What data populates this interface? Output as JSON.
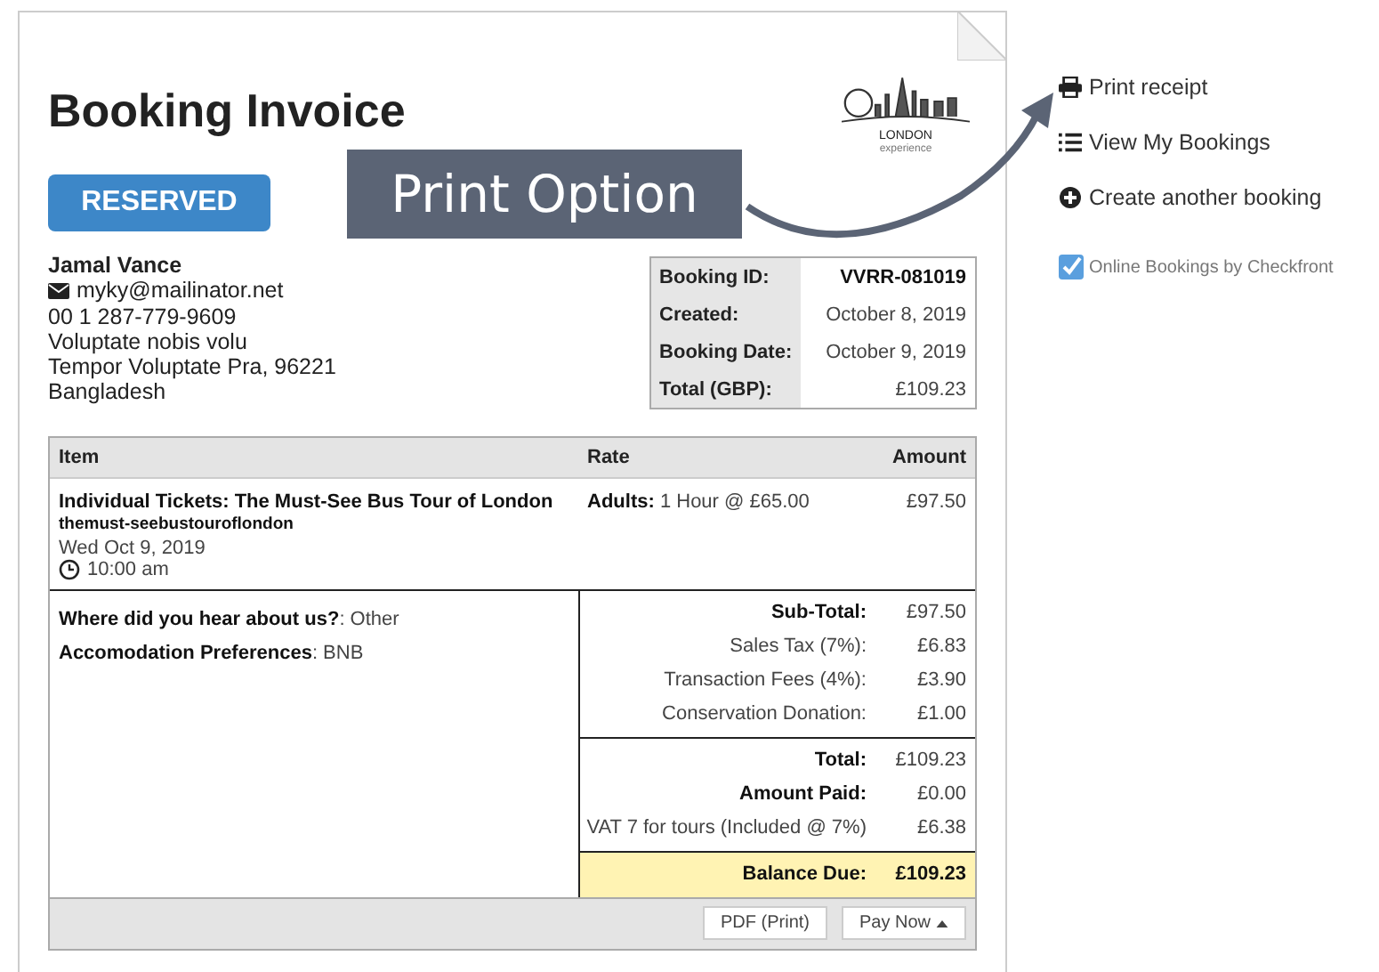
{
  "invoice": {
    "title": "Booking Invoice",
    "logo": {
      "line_1": "LONDON",
      "line_2": "experience"
    },
    "status": "RESERVED",
    "customer": {
      "name": "Jamal Vance",
      "email": "myky@mailinator.net",
      "phone": "00 1 287-779-9609",
      "address_lines": [
        "Voluptate nobis volu",
        "Tempor Voluptate Pra, 96221",
        "Bangladesh"
      ]
    },
    "summary": [
      {
        "label": "Booking ID:",
        "value": "VVRR-081019",
        "bold": true
      },
      {
        "label": "Created:",
        "value": "October 8, 2019",
        "bold": false
      },
      {
        "label": "Booking Date:",
        "value": "October 9, 2019",
        "bold": false
      },
      {
        "label": "Total (GBP):",
        "value": "£109.23",
        "bold": false
      }
    ],
    "table": {
      "columns": [
        "Item",
        "Rate",
        "Amount"
      ],
      "rows": [
        {
          "title": "Individual Tickets: The Must-See Bus Tour of London",
          "code": "themust-seebustouroflondon",
          "date": "Wed Oct 9, 2019",
          "time": "10:00 am",
          "rate": "**Adults:** 1 Hour @ £65.00",
          "amount": "£97.50"
        }
      ]
    },
    "questions": [
      "**Where did you hear about us?**: Other",
      "**Accomodation Preferences**: BNB"
    ],
    "totals": [
      [
        {
          "label": "Sub-Total:",
          "value": "£97.50",
          "kind": "strong"
        },
        {
          "label": "Sales Tax (7%):",
          "value": "£6.83",
          "kind": "normal"
        },
        {
          "label": "Transaction Fees (4%):",
          "value": "£3.90",
          "kind": "normal"
        },
        {
          "label": "Conservation Donation:",
          "value": "£1.00",
          "kind": "normal"
        }
      ],
      [
        {
          "label": "Total:",
          "value": "£109.23",
          "kind": "strong"
        },
        {
          "label": "Amount Paid:",
          "value": "£0.00",
          "kind": "strong"
        },
        {
          "label": "VAT 7 for tours (Included @ 7%)",
          "value": "£6.38",
          "kind": "normal"
        }
      ],
      [
        {
          "label": "Balance Due:",
          "value": "£109.23",
          "kind": "due"
        }
      ]
    ],
    "buttons": [
      {
        "label": "PDF (Print)",
        "kind": "plain"
      },
      {
        "label": "Pay Now",
        "kind": "dropdown"
      }
    ]
  },
  "sidebar": {
    "links": [
      {
        "label": "Print receipt",
        "kind": "print"
      },
      {
        "label": "View My Bookings",
        "kind": "list"
      },
      {
        "label": "Create another booking",
        "kind": "add"
      }
    ],
    "powered_by": "Online Bookings by Checkfront"
  },
  "callout": "Print Option"
}
